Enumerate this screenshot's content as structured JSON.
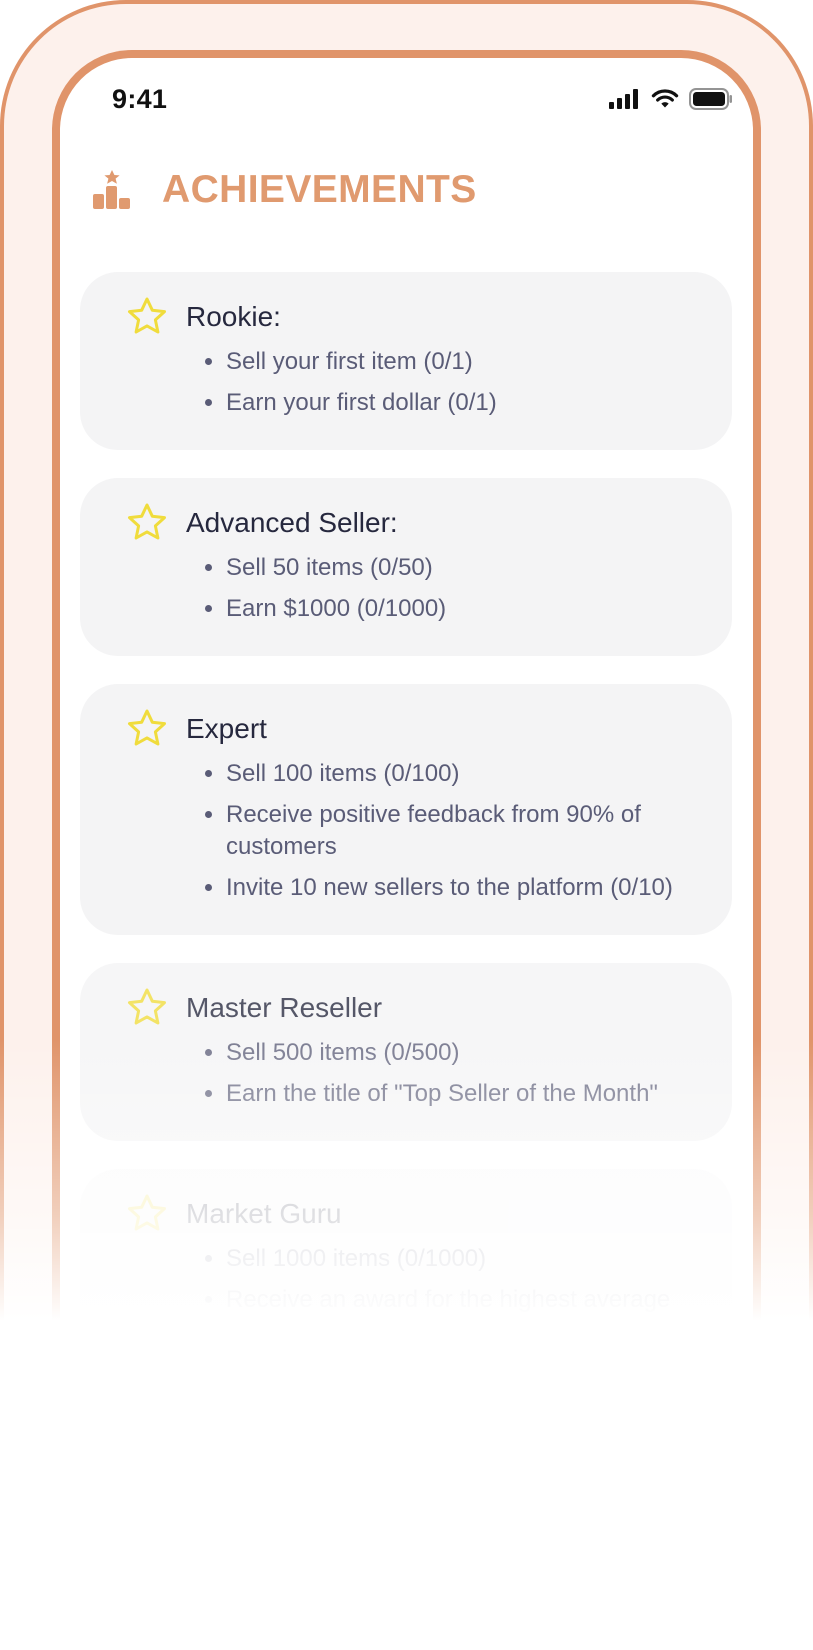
{
  "status_bar": {
    "time": "9:41",
    "icons": [
      "signal-icon",
      "wifi-icon",
      "battery-icon"
    ]
  },
  "header": {
    "title": "ACHIEVEMENTS",
    "icon": "trophy-podium-icon",
    "color": "#e09a6f"
  },
  "colors": {
    "frame": "#e0946a",
    "card_background": "#f4f4f5",
    "star": "#f0dc3c"
  },
  "achievements": [
    {
      "title": "Rookie:",
      "icon": "star-icon",
      "tasks": [
        "Sell your first item (0/1)",
        "Earn your first dollar  (0/1)"
      ]
    },
    {
      "title": "Advanced Seller:",
      "icon": "star-icon",
      "tasks": [
        "Sell 50 items (0/50)",
        "Earn $1000 (0/1000)"
      ]
    },
    {
      "title": "Expert",
      "icon": "star-icon",
      "tasks": [
        "Sell 100 items (0/100)",
        "Receive positive feedback from 90% of customers",
        "Invite 10 new sellers to the platform (0/10)"
      ]
    },
    {
      "title": "Master Reseller",
      "icon": "star-icon",
      "tasks": [
        "Sell 500 items (0/500)",
        "Earn the title of \"Top Seller of the Month\""
      ]
    },
    {
      "title": "Market Guru",
      "icon": "star-icon",
      "tasks": [
        "Sell 1000 items (0/1000)",
        "Receive an award for the highest average customer rating"
      ]
    }
  ]
}
